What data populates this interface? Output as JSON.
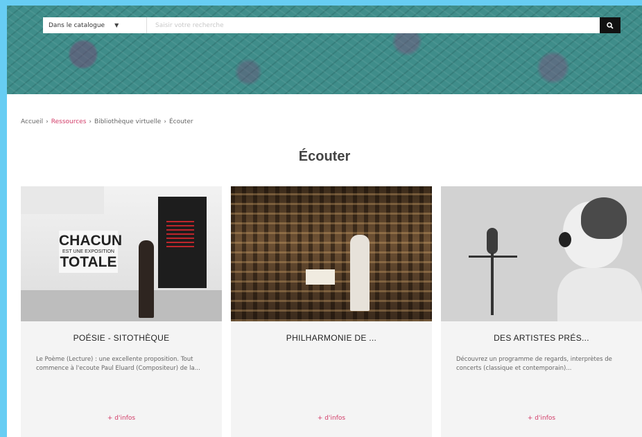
{
  "search": {
    "scope_label": "Dans le catalogue",
    "placeholder": "Saisir votre recherche"
  },
  "breadcrumb": {
    "home": "Accueil",
    "level1": "Ressources",
    "level2": "Bibliothèque virtuelle",
    "current": "Écouter",
    "separator": "›"
  },
  "page_title": "Écouter",
  "cards": [
    {
      "title": "POÉSIE - SITOTHÈQUE",
      "description": "Le Poème (Lecture) : une excellente proposition. Tout commence à l'ecoute Paul Eluard (Compositeur) de la...",
      "more": "+ d'infos"
    },
    {
      "title": "PHILHARMONIE DE ...",
      "description": "",
      "more": "+ d'infos"
    },
    {
      "title": "DES ARTISTES PRÉS...",
      "description": "Découvrez un programme de regards, interprètes de concerts (classique et contemporain)...",
      "more": "+ d'infos"
    }
  ],
  "exhibit_text": {
    "line1": "CHACUN",
    "line2": "EST UNE EXPOSITION",
    "line3": "TOTALE"
  },
  "colors": {
    "accent": "#d23c68",
    "banner": "#3f8d8a",
    "frame": "#67cdf3"
  },
  "icons": {
    "search_button": "search-icon",
    "scope_dropdown": "chevron-down-icon"
  }
}
